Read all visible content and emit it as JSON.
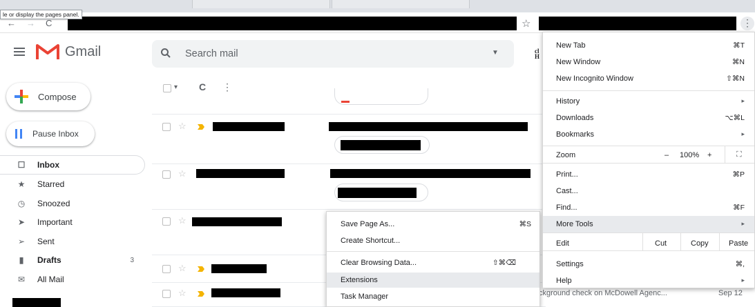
{
  "tooltip": "le or display the pages panel.",
  "toolbar": {
    "back": "←",
    "forward": "→",
    "reload": "C",
    "bookmark_star": "☆",
    "menu": "⋮"
  },
  "gmail": {
    "app_name": "Gmail",
    "search_placeholder": "Search mail",
    "compose": "Compose",
    "pause_inbox": "Pause Inbox",
    "nav": [
      {
        "label": "Inbox",
        "icon": "inbox-icon",
        "glyph": "☐"
      },
      {
        "label": "Starred",
        "icon": "star-icon",
        "glyph": "★"
      },
      {
        "label": "Snoozed",
        "icon": "clock-icon",
        "glyph": "◷"
      },
      {
        "label": "Important",
        "icon": "important-icon",
        "glyph": "➤"
      },
      {
        "label": "Sent",
        "icon": "send-icon",
        "glyph": "➢"
      },
      {
        "label": "Drafts",
        "icon": "draft-icon",
        "glyph": "▮",
        "count": "3"
      },
      {
        "label": "All Mail",
        "icon": "mail-icon",
        "glyph": "✉"
      }
    ],
    "list_toolbar": {
      "select": "☐",
      "dropdown": "▾",
      "refresh": "C",
      "more": "⋮"
    },
    "partial_snippet": "ckground check on McDowell Agenc...",
    "partial_date": "Sep 12",
    "partial_logo": "H"
  },
  "chrome_menu": {
    "new_tab": "New Tab",
    "new_tab_sc": "⌘T",
    "new_window": "New Window",
    "new_window_sc": "⌘N",
    "new_incognito": "New Incognito Window",
    "new_incognito_sc": "⇧⌘N",
    "history": "History",
    "downloads": "Downloads",
    "downloads_sc": "⌥⌘L",
    "bookmarks": "Bookmarks",
    "zoom": "Zoom",
    "zoom_minus": "–",
    "zoom_value": "100%",
    "zoom_plus": "+",
    "fullscreen": "⛶",
    "print": "Print...",
    "print_sc": "⌘P",
    "cast": "Cast...",
    "find": "Find...",
    "find_sc": "⌘F",
    "more_tools": "More Tools",
    "edit": "Edit",
    "cut": "Cut",
    "copy": "Copy",
    "paste": "Paste",
    "settings": "Settings",
    "settings_sc": "⌘,",
    "help": "Help",
    "arrow": "▸"
  },
  "more_tools_menu": {
    "save_page": "Save Page As...",
    "save_page_sc": "⌘S",
    "create_shortcut": "Create Shortcut...",
    "clear_data": "Clear Browsing Data...",
    "clear_data_sc": "⇧⌘⌫",
    "extensions": "Extensions",
    "task_manager": "Task Manager"
  },
  "colors": {
    "gmail_red": "#ea4335",
    "highlight": "#e8eaed",
    "important": "#f4b400"
  }
}
